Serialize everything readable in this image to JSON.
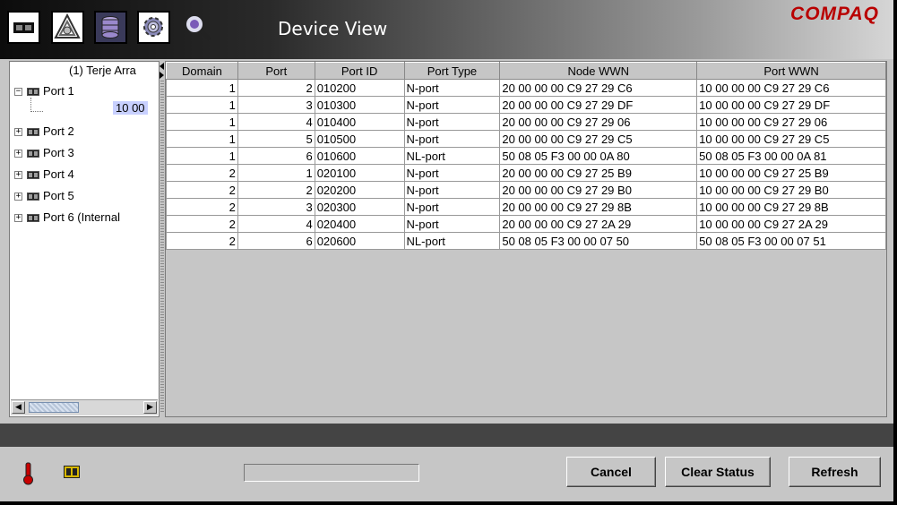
{
  "window": {
    "title": "Device View",
    "brand": "COMPAQ"
  },
  "toolbar": {
    "buttons": [
      {
        "icon": "device-icon"
      },
      {
        "icon": "fabric-icon"
      },
      {
        "icon": "database-icon"
      },
      {
        "icon": "gear-icon"
      },
      {
        "icon": "magnifier-help-icon"
      }
    ]
  },
  "tree": {
    "root": "(1) Terje Arra",
    "port1": "Port 1",
    "port1_child": "10 00",
    "port2": "Port 2",
    "port3": "Port 3",
    "port4": "Port 4",
    "port5": "Port 5",
    "port6": "Port 6 (Internal"
  },
  "table": {
    "headers": [
      "Domain",
      "Port",
      "Port ID",
      "Port Type",
      "Node WWN",
      "Port WWN"
    ],
    "rows": [
      [
        "1",
        "2",
        "010200",
        "N-port",
        "20 00 00 00 C9 27 29 C6",
        "10 00 00 00 C9 27 29 C6"
      ],
      [
        "1",
        "3",
        "010300",
        "N-port",
        "20 00 00 00 C9 27 29 DF",
        "10 00 00 00 C9 27 29 DF"
      ],
      [
        "1",
        "4",
        "010400",
        "N-port",
        "20 00 00 00 C9 27 29 06",
        "10 00 00 00 C9 27 29 06"
      ],
      [
        "1",
        "5",
        "010500",
        "N-port",
        "20 00 00 00 C9 27 29 C5",
        "10 00 00 00 C9 27 29 C5"
      ],
      [
        "1",
        "6",
        "010600",
        "NL-port",
        "50 08 05 F3 00 00 0A 80",
        "50 08 05 F3 00 00 0A 81"
      ],
      [
        "2",
        "1",
        "020100",
        "N-port",
        "20 00 00 00 C9 27 25 B9",
        "10 00 00 00 C9 27 25 B9"
      ],
      [
        "2",
        "2",
        "020200",
        "N-port",
        "20 00 00 00 C9 27 29 B0",
        "10 00 00 00 C9 27 29 B0"
      ],
      [
        "2",
        "3",
        "020300",
        "N-port",
        "20 00 00 00 C9 27 29 8B",
        "10 00 00 00 C9 27 29 8B"
      ],
      [
        "2",
        "4",
        "020400",
        "N-port",
        "20 00 00 00 C9 27 2A 29",
        "10 00 00 00 C9 27 2A 29"
      ],
      [
        "2",
        "6",
        "020600",
        "NL-port",
        "50 08 05 F3 00 00 07 50",
        "50 08 05 F3 00 00 07 51"
      ]
    ]
  },
  "buttons": {
    "cancel": "Cancel",
    "clear_status": "Clear Status",
    "refresh": "Refresh"
  },
  "status_icons": [
    "thermometer-icon",
    "switch-icon"
  ],
  "colors": {
    "brand": "#b90000",
    "tree_selection": "#c8d0ff",
    "status_bar": "#444444"
  }
}
